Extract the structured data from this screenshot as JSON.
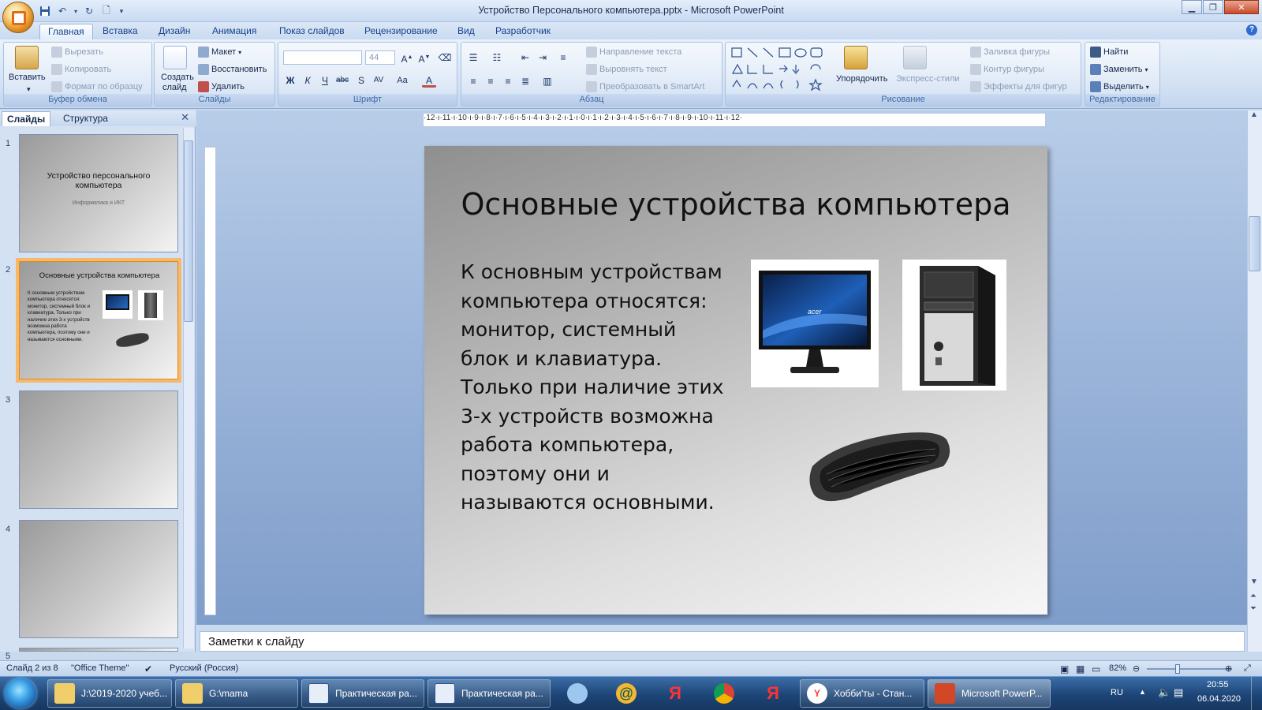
{
  "window": {
    "title": "Устройство Персонального компьютера.pptx - Microsoft PowerPoint"
  },
  "tabs": [
    "Главная",
    "Вставка",
    "Дизайн",
    "Анимация",
    "Показ слайдов",
    "Рецензирование",
    "Вид",
    "Разработчик"
  ],
  "active_tab": "Главная",
  "ribbon": {
    "clipboard": {
      "label": "Буфер обмена",
      "paste": "Вставить",
      "cut": "Вырезать",
      "copy": "Копировать",
      "format_painter": "Формат по образцу"
    },
    "slides": {
      "label": "Слайды",
      "new_slide_1": "Создать",
      "new_slide_2": "слайд",
      "layout": "Макет",
      "reset": "Восстановить",
      "delete": "Удалить"
    },
    "font": {
      "label": "Шрифт",
      "size": "44"
    },
    "paragraph": {
      "label": "Абзац",
      "text_direction": "Направление текста",
      "align_text": "Выровнять текст",
      "smartart": "Преобразовать в SmartArt"
    },
    "drawing": {
      "label": "Рисование",
      "arrange": "Упорядочить",
      "quick_styles": "Экспресс-стили",
      "shape_fill": "Заливка фигуры",
      "shape_outline": "Контур фигуры",
      "shape_effects": "Эффекты для фигур"
    },
    "editing": {
      "label": "Редактирование",
      "find": "Найти",
      "replace": "Заменить",
      "select": "Выделить"
    }
  },
  "left_pane": {
    "tabs": [
      "Слайды",
      "Структура"
    ],
    "slides": [
      {
        "num": "1",
        "title": "Устройство персонального компьютера",
        "subtitle": "Информатика и ИКТ"
      },
      {
        "num": "2",
        "title": "Основные устройства компьютера",
        "body": "К основным устройствам компьютера относятся: монитор, системный блок и клавиатура. Только при наличие этих 3-х устройств возможна работа компьютера, поэтому они и называются основными."
      },
      {
        "num": "3"
      },
      {
        "num": "4"
      },
      {
        "num": "5"
      }
    ]
  },
  "ruler": {
    "horizontal": "·12·ı·11·ı·10·ı·9·ı·8·ı·7·ı·6·ı·5·ı·4·ı·3·ı·2·ı·1·ı·0·ı·1·ı·2·ı·3·ı·4·ı·5·ı·6·ı·7·ı·8·ı·9·ı·10·ı·11·ı·12·"
  },
  "slide": {
    "title": "Основные устройства компьютера",
    "body_lines": [
      "К основным устройствам",
      "компьютера относятся:",
      "монитор, системный",
      "блок и клавиатура.",
      "Только при наличие этих",
      "3-х устройств возможна",
      "работа компьютера,",
      "поэтому они и",
      "называются основными."
    ],
    "monitor_brand": "acer"
  },
  "notes": {
    "placeholder": "Заметки к слайду"
  },
  "status": {
    "slide": "Слайд 2 из 8",
    "theme": "\"Office Theme\"",
    "language": "Русский (Россия)",
    "zoom": "82%"
  },
  "taskbar": {
    "items": [
      "J:\\2019-2020 учеб...",
      "G:\\mama",
      "Практическая ра...",
      "Практическая ра...",
      "Хобби'ты - Стан...",
      "Microsoft PowerP..."
    ],
    "lang": "RU",
    "time": "20:55",
    "date": "06.04.2020"
  },
  "colors": {
    "accent": "#15428b",
    "selection": "#f6b86a",
    "taskbar": "#1d4577"
  }
}
